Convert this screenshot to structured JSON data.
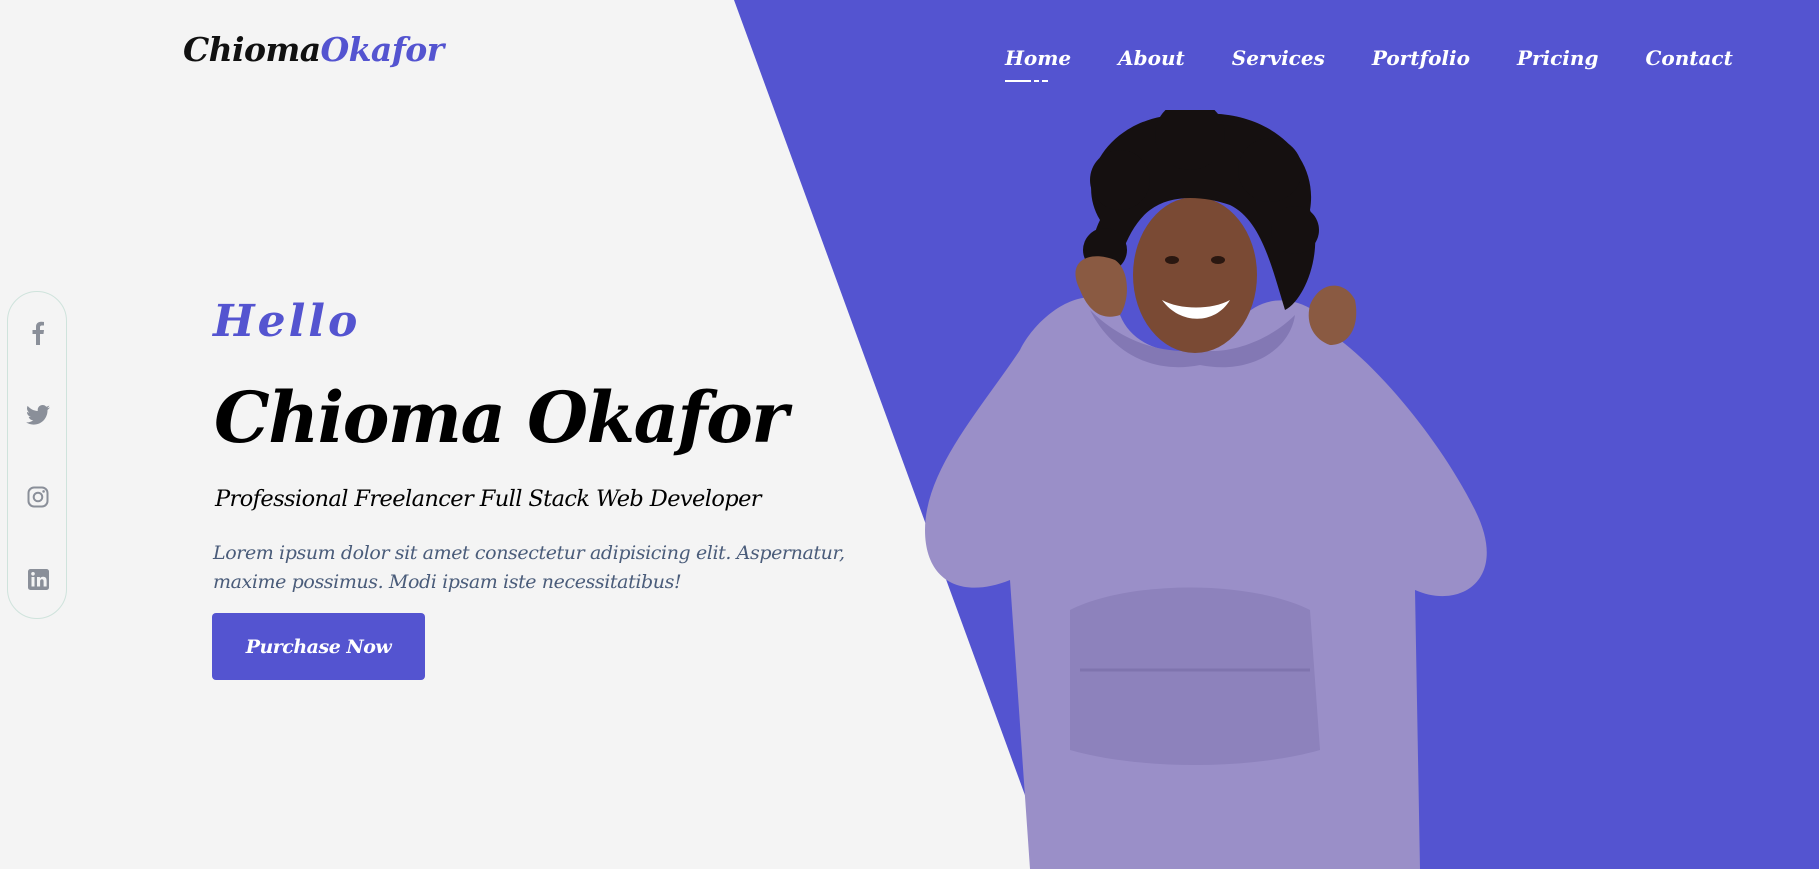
{
  "brand": {
    "first": "Chioma",
    "last": "Okafor"
  },
  "nav": {
    "items": [
      {
        "label": "Home",
        "active": true
      },
      {
        "label": "About",
        "active": false
      },
      {
        "label": "Services",
        "active": false
      },
      {
        "label": "Portfolio",
        "active": false
      },
      {
        "label": "Pricing",
        "active": false
      },
      {
        "label": "Contact",
        "active": false
      }
    ]
  },
  "social": [
    {
      "icon": "facebook-icon"
    },
    {
      "icon": "twitter-icon"
    },
    {
      "icon": "instagram-icon"
    },
    {
      "icon": "linkedin-icon"
    }
  ],
  "hero": {
    "greeting": "Hello",
    "name": "Chioma Okafor",
    "role": "Professional Freelancer Full Stack Web Developer",
    "description": "Lorem ipsum dolor sit amet consectetur adipisicing elit. Aspernatur, maxime possimus. Modi ipsam iste necessitatibus!",
    "cta_label": "Purchase Now"
  },
  "colors": {
    "accent": "#5454d0",
    "background": "#f4f4f4",
    "text_dark": "#000000",
    "text_muted": "#4a5c7a",
    "hoodie": "#9a8fc8"
  }
}
